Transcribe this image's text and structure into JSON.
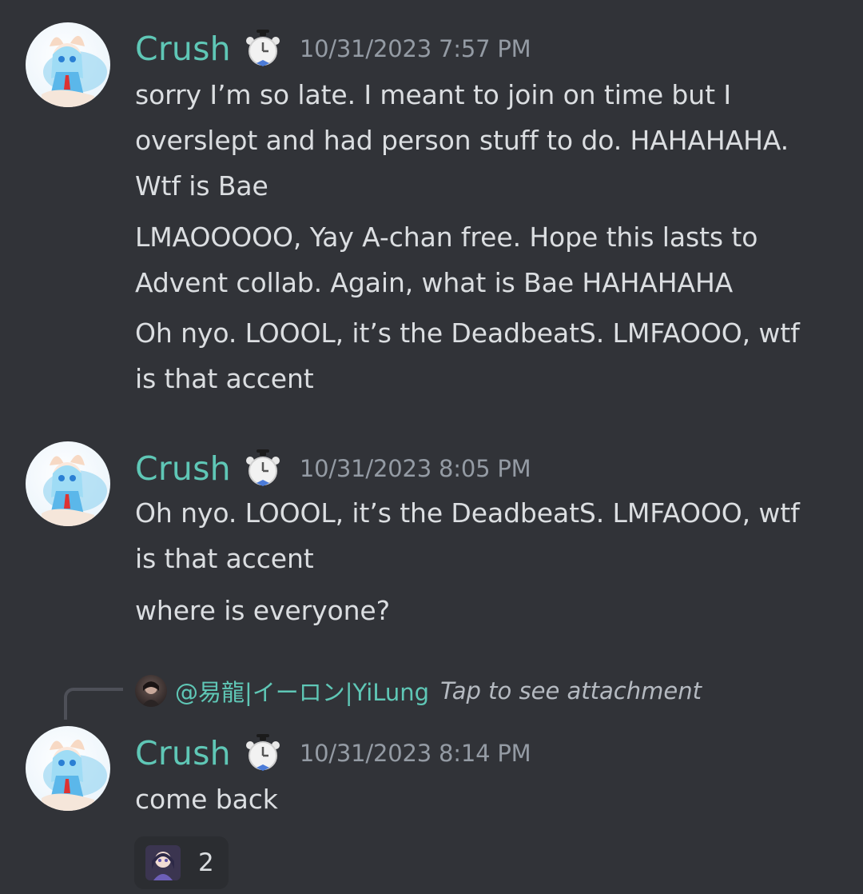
{
  "messages": [
    {
      "username": "Crush",
      "timestamp": "10/31/2023 7:57 PM",
      "lines": [
        "sorry I’m so late. I meant to join on time but I",
        "overslept and had person stuff to do. HAHAHAHA.",
        "Wtf is Bae",
        "LMAOOOOO, Yay A-chan free. Hope this lasts to",
        "Advent collab. Again, what is Bae HAHAHAHA",
        "Oh nyo. LOOOL, it’s the DeadbeatS. LMFAOOO, wtf",
        "is that accent"
      ]
    },
    {
      "username": "Crush",
      "timestamp": "10/31/2023 8:05 PM",
      "lines": [
        "Oh nyo. LOOOL, it’s the DeadbeatS. LMFAOOO, wtf",
        "is that accent",
        "where is everyone?"
      ]
    },
    {
      "reply": {
        "user": "@易龍|イーロン|YiLung",
        "text": "Tap to see attachment"
      },
      "username": "Crush",
      "timestamp": "10/31/2023 8:14 PM",
      "lines": [
        "come back"
      ],
      "reaction": {
        "emoji": "custom-character-emoji",
        "count": "2"
      }
    }
  ],
  "colors": {
    "background": "#313338",
    "username": "#5fc7b6",
    "timestamp": "#949ba4",
    "text": "#dbdee1"
  }
}
